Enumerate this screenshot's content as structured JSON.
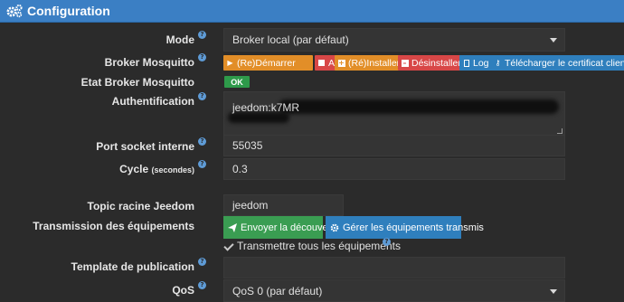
{
  "header": {
    "title": "Configuration",
    "icon": "cogs-icon"
  },
  "labels": {
    "mode": "Mode",
    "broker": "Broker Mosquitto",
    "etat": "Etat Broker Mosquitto",
    "auth": "Authentification",
    "port": "Port socket interne",
    "cycle": "Cycle",
    "cycle_unit": "(secondes)",
    "topic": "Topic racine Jeedom",
    "transmission": "Transmission des équipements",
    "template": "Template de publication",
    "qos": "QoS"
  },
  "fields": {
    "mode_value": "Broker local (par défaut)",
    "auth_value": "jeedom:k7MR",
    "port_value": "55035",
    "cycle_value": "0.3",
    "topic_value": "jeedom",
    "template_value": "",
    "qos_value": "QoS 0 (par défaut)"
  },
  "broker_buttons": [
    {
      "label": "(Re)Démarrer",
      "icon": "play-icon",
      "color": "orange"
    },
    {
      "label": "Arrêter",
      "icon": "stop-icon",
      "color": "red"
    },
    {
      "label": "(Ré)Installer",
      "icon": "plus-square-icon",
      "color": "orange"
    },
    {
      "label": "Désinstaller",
      "icon": "minus-square-icon",
      "color": "red"
    },
    {
      "label": "Log",
      "icon": "file-icon",
      "color": "blue"
    },
    {
      "label": "Télécharger le certificat client",
      "icon": "key-icon",
      "color": "blue"
    }
  ],
  "status": {
    "ok_label": "OK"
  },
  "transmission": {
    "discovery_label": "Envoyer la découverte",
    "manage_label": "Gérer les équipements transmis",
    "checkbox_label": "Transmettre tous les équipements",
    "checkbox_checked": true
  },
  "colors": {
    "header_bg": "#3b7fc4",
    "page_bg": "#2b2b2b",
    "field_bg": "#343434",
    "orange": "#e28e28",
    "red": "#d84747",
    "blue": "#2f7fbd",
    "green": "#3a9d52",
    "help_icon": "#5e9bd6"
  }
}
